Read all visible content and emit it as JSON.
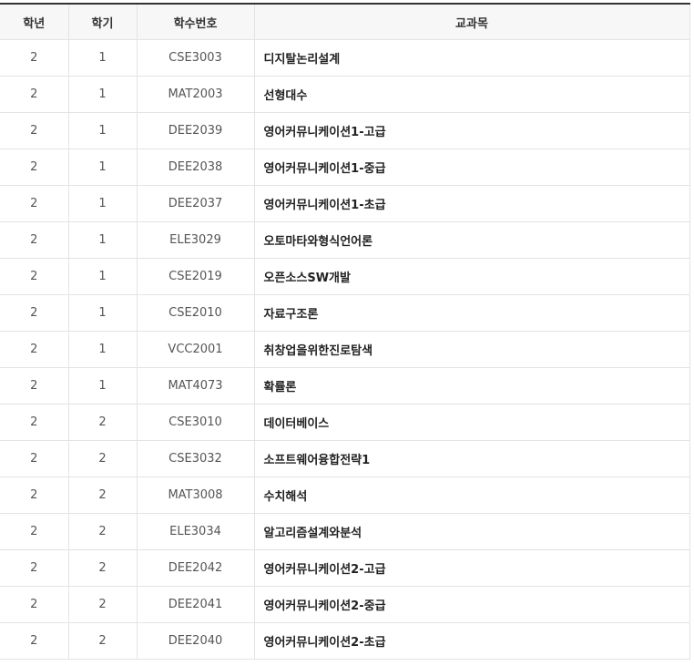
{
  "table": {
    "headers": [
      "학년",
      "학기",
      "학수번호",
      "교과목"
    ],
    "rows": [
      {
        "year": "2",
        "semester": "1",
        "code": "CSE3003",
        "subject": "디지탈논리설계"
      },
      {
        "year": "2",
        "semester": "1",
        "code": "MAT2003",
        "subject": "선형대수"
      },
      {
        "year": "2",
        "semester": "1",
        "code": "DEE2039",
        "subject": "영어커뮤니케이션1-고급"
      },
      {
        "year": "2",
        "semester": "1",
        "code": "DEE2038",
        "subject": "영어커뮤니케이션1-중급"
      },
      {
        "year": "2",
        "semester": "1",
        "code": "DEE2037",
        "subject": "영어커뮤니케이션1-초급"
      },
      {
        "year": "2",
        "semester": "1",
        "code": "ELE3029",
        "subject": "오토마타와형식언어론"
      },
      {
        "year": "2",
        "semester": "1",
        "code": "CSE2019",
        "subject": "오픈소스SW개발"
      },
      {
        "year": "2",
        "semester": "1",
        "code": "CSE2010",
        "subject": "자료구조론"
      },
      {
        "year": "2",
        "semester": "1",
        "code": "VCC2001",
        "subject": "취창업을위한진로탐색"
      },
      {
        "year": "2",
        "semester": "1",
        "code": "MAT4073",
        "subject": "확률론"
      },
      {
        "year": "2",
        "semester": "2",
        "code": "CSE3010",
        "subject": "데이터베이스"
      },
      {
        "year": "2",
        "semester": "2",
        "code": "CSE3032",
        "subject": "소프트웨어융합전략1"
      },
      {
        "year": "2",
        "semester": "2",
        "code": "MAT3008",
        "subject": "수치해석"
      },
      {
        "year": "2",
        "semester": "2",
        "code": "ELE3034",
        "subject": "알고리즘설계와분석"
      },
      {
        "year": "2",
        "semester": "2",
        "code": "DEE2042",
        "subject": "영어커뮤니케이션2-고급"
      },
      {
        "year": "2",
        "semester": "2",
        "code": "DEE2041",
        "subject": "영어커뮤니케이션2-중급"
      },
      {
        "year": "2",
        "semester": "2",
        "code": "DEE2040",
        "subject": "영어커뮤니케이션2-초급"
      }
    ]
  }
}
